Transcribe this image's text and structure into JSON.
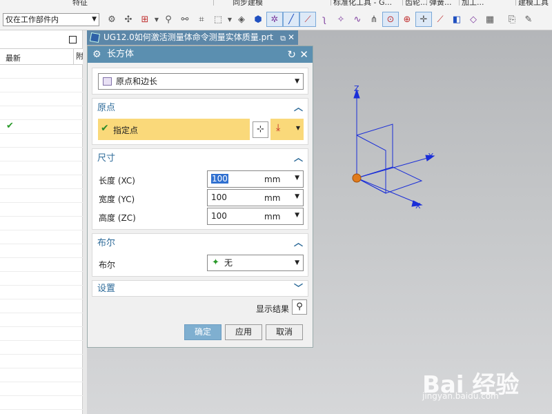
{
  "ribbon_groups": [
    "特征",
    "同步建模",
    "标准化工具 - G...",
    "齿轮...",
    "弹簧...",
    "加工...",
    "建模工具"
  ],
  "filter": {
    "value": "仅在工作部件内"
  },
  "left_panel": {
    "col_newest": "最新",
    "col_other": "附"
  },
  "graphics": {
    "tab_title": "UG12.0如何激活测量体命令测量实体质量.prt"
  },
  "axes": {
    "x": "X",
    "y": "Y",
    "z": "Z"
  },
  "dialog": {
    "title": "长方体",
    "type_select": "原点和边长",
    "origin": {
      "header": "原点",
      "specify_point": "指定点"
    },
    "dimensions": {
      "header": "尺寸",
      "length_label": "长度 (XC)",
      "length_value": "100",
      "width_label": "宽度 (YC)",
      "width_value": "100",
      "height_label": "高度 (ZC)",
      "height_value": "100",
      "unit": "mm"
    },
    "boolean": {
      "header": "布尔",
      "label": "布尔",
      "value": "无"
    },
    "settings": {
      "header": "设置"
    },
    "show_result": "显示结果",
    "buttons": {
      "ok": "确定",
      "apply": "应用",
      "cancel": "取消"
    }
  },
  "watermark": {
    "main": "Bai 经验",
    "sub": "jingyan.baidu.com"
  }
}
